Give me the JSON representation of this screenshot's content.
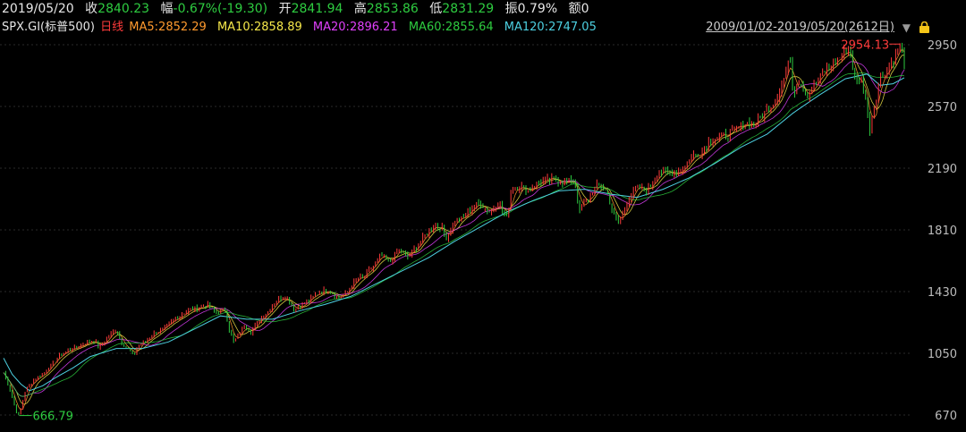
{
  "header": {
    "date": "2019/05/20",
    "close_label": "收",
    "close_value": "2840.23",
    "change_label": "幅",
    "change_value": "-0.67%(-19.30)",
    "open_label": "开",
    "open_value": "2841.94",
    "high_label": "高",
    "high_value": "2853.86",
    "low_label": "低",
    "low_value": "2831.29",
    "amp_label": "振",
    "amp_value": "0.79%",
    "amount_label": "额",
    "amount_value": "0"
  },
  "indicator_bar": {
    "symbol": "SPX.GI(标普500)",
    "period": "日线",
    "ma5": "MA5:2852.29",
    "ma10": "MA10:2858.89",
    "ma20": "MA20:2896.21",
    "ma60": "MA60:2855.64",
    "ma120": "MA120:2747.05",
    "range": "2009/01/02-2019/05/20(2612日)"
  },
  "colors": {
    "up": "#ff3b3b",
    "down": "#2ecc40",
    "ma5": "#ff9a2e",
    "ma10": "#f5e74a",
    "ma20": "#e040fb",
    "ma60": "#2ecc40",
    "ma120": "#4dd0e1",
    "grid": "#2a2a2a",
    "lock": "#f5c518"
  },
  "chart_data": {
    "type": "line",
    "x_range": [
      "2009/01/02",
      "2019/05/20"
    ],
    "ylim": [
      670,
      2950
    ],
    "y_ticks": [
      "2950",
      "2570",
      "2190",
      "1810",
      "1430",
      "1050",
      "670"
    ],
    "y_tick_values": [
      2950,
      2570,
      2190,
      1810,
      1430,
      1050,
      670
    ],
    "annotations": {
      "low_label": "666.79",
      "low_value": 666.79,
      "high_label": "2954.13",
      "high_value": 2954.13
    },
    "series": [
      {
        "key": "price",
        "x": [
          2009.0,
          2009.05,
          2009.1,
          2009.14,
          2009.18,
          2009.25,
          2009.35,
          2009.45,
          2009.55,
          2009.65,
          2009.75,
          2009.85,
          2009.95,
          2010.05,
          2010.1,
          2010.2,
          2010.3,
          2010.35,
          2010.45,
          2010.5,
          2010.55,
          2010.65,
          2010.75,
          2010.85,
          2010.95,
          2011.05,
          2011.15,
          2011.25,
          2011.35,
          2011.45,
          2011.55,
          2011.6,
          2011.65,
          2011.7,
          2011.78,
          2011.85,
          2011.95,
          2012.05,
          2012.15,
          2012.25,
          2012.35,
          2012.45,
          2012.55,
          2012.65,
          2012.75,
          2012.85,
          2012.95,
          2013.05,
          2013.15,
          2013.25,
          2013.35,
          2013.45,
          2013.55,
          2013.65,
          2013.75,
          2013.85,
          2013.95,
          2014.05,
          2014.1,
          2014.2,
          2014.3,
          2014.4,
          2014.5,
          2014.6,
          2014.7,
          2014.8,
          2014.85,
          2014.95,
          2015.05,
          2015.15,
          2015.25,
          2015.35,
          2015.45,
          2015.55,
          2015.6,
          2015.63,
          2015.66,
          2015.75,
          2015.85,
          2015.95,
          2016.02,
          2016.08,
          2016.12,
          2016.2,
          2016.3,
          2016.4,
          2016.48,
          2016.55,
          2016.65,
          2016.75,
          2016.85,
          2016.95,
          2017.05,
          2017.15,
          2017.25,
          2017.35,
          2017.45,
          2017.55,
          2017.65,
          2017.75,
          2017.85,
          2017.95,
          2018.02,
          2018.07,
          2018.1,
          2018.15,
          2018.2,
          2018.25,
          2018.35,
          2018.45,
          2018.55,
          2018.65,
          2018.72,
          2018.76,
          2018.82,
          2018.88,
          2018.93,
          2018.98,
          2019.02,
          2019.1,
          2019.2,
          2019.28,
          2019.33,
          2019.36,
          2019.38
        ],
        "values": [
          931,
          860,
          780,
          700,
          667,
          820,
          890,
          920,
          980,
          1040,
          1070,
          1090,
          1115,
          1130,
          1080,
          1150,
          1200,
          1120,
          1070,
          1030,
          1100,
          1130,
          1180,
          1200,
          1250,
          1290,
          1320,
          1330,
          1350,
          1300,
          1320,
          1200,
          1120,
          1150,
          1230,
          1180,
          1260,
          1310,
          1380,
          1400,
          1320,
          1350,
          1390,
          1430,
          1440,
          1390,
          1420,
          1500,
          1520,
          1580,
          1650,
          1610,
          1690,
          1640,
          1700,
          1770,
          1840,
          1820,
          1760,
          1870,
          1880,
          1950,
          1970,
          1920,
          1980,
          1880,
          2060,
          2080,
          2050,
          2100,
          2110,
          2120,
          2100,
          2110,
          2090,
          1900,
          1950,
          2010,
          2090,
          2050,
          1920,
          1860,
          1880,
          2000,
          2070,
          2050,
          2100,
          2170,
          2160,
          2160,
          2200,
          2270,
          2290,
          2370,
          2380,
          2400,
          2430,
          2470,
          2460,
          2520,
          2580,
          2670,
          2790,
          2870,
          2640,
          2740,
          2700,
          2640,
          2700,
          2780,
          2830,
          2880,
          2920,
          2890,
          2700,
          2750,
          2640,
          2420,
          2540,
          2740,
          2810,
          2890,
          2945,
          2900,
          2840
        ]
      },
      {
        "key": "ma120",
        "x": [
          2009.0,
          2009.1,
          2009.2,
          2009.3,
          2009.45,
          2009.6,
          2009.8,
          2010.0,
          2010.3,
          2010.6,
          2010.9,
          2011.2,
          2011.5,
          2011.8,
          2012.1,
          2012.4,
          2012.7,
          2013.0,
          2013.3,
          2013.6,
          2013.9,
          2014.2,
          2014.5,
          2014.8,
          2015.1,
          2015.4,
          2015.7,
          2016.0,
          2016.3,
          2016.6,
          2016.9,
          2017.2,
          2017.5,
          2017.8,
          2018.1,
          2018.4,
          2018.7,
          2018.95,
          2019.1,
          2019.25,
          2019.38
        ],
        "values": [
          1020,
          920,
          860,
          820,
          850,
          900,
          960,
          1030,
          1080,
          1080,
          1120,
          1200,
          1280,
          1260,
          1260,
          1310,
          1350,
          1400,
          1480,
          1560,
          1640,
          1740,
          1830,
          1920,
          1990,
          2050,
          2060,
          2030,
          2010,
          2060,
          2130,
          2220,
          2320,
          2400,
          2530,
          2640,
          2740,
          2770,
          2700,
          2710,
          2747
        ]
      }
    ]
  }
}
